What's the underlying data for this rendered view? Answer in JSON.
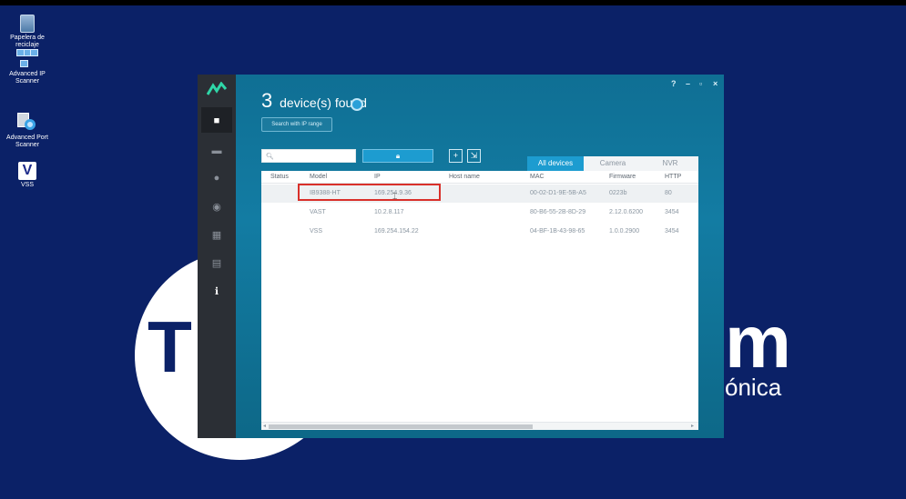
{
  "desktop": {
    "icons": [
      {
        "label": "Papelera de reciclaje",
        "icon": "recycle-bin-icon"
      },
      {
        "label": "Advanced IP Scanner",
        "icon": "network-scanner-icon"
      },
      {
        "label": "Advanced Port Scanner",
        "icon": "port-scanner-icon"
      },
      {
        "label": "VSS",
        "icon": "vss-app-icon"
      }
    ],
    "background_text": {
      "left": "T",
      "right_big": "m",
      "right_small": "ónica"
    },
    "colors": {
      "background": "#0b2167",
      "logo_circle": "#ffffff"
    }
  },
  "window": {
    "controls": {
      "help": "?",
      "minimize": "–",
      "maximize": "▫",
      "close": "×"
    },
    "title": {
      "count": "3",
      "text": "device(s) found"
    },
    "ip_range_button": "Search with IP range",
    "search_placeholder": "",
    "toolbar": {
      "lock_icon": "lock-icon",
      "add": "+",
      "import": "import-icon"
    },
    "tabs": [
      {
        "label": "All devices",
        "active": true
      },
      {
        "label": "Camera",
        "active": false
      },
      {
        "label": "NVR",
        "active": false
      }
    ],
    "sidebar_icons": [
      "home-icon",
      "monitor-icon",
      "location-icon",
      "playback-icon",
      "grid-icon",
      "report-icon",
      "info-icon"
    ],
    "columns": [
      "Status",
      "Model",
      "IP",
      "Host name",
      "MAC",
      "Firmware",
      "HTTP"
    ],
    "rows": [
      {
        "status": "",
        "model": "IB9388-HT",
        "ip": "169.254.9.36",
        "host": "",
        "mac": "00-02-D1-9E-5B-A5",
        "firmware": "0223b",
        "http": "80",
        "selected": true
      },
      {
        "status": "",
        "model": "VAST",
        "ip": "10.2.8.117",
        "host": "",
        "mac": "80-B6-55-2B-8D-29",
        "firmware": "2.12.0.6200",
        "http": "3454",
        "selected": false
      },
      {
        "status": "",
        "model": "VSS",
        "ip": "169.254.154.22",
        "host": "",
        "mac": "04-BF-1B-43-98-65",
        "firmware": "1.0.0.2900",
        "http": "3454",
        "selected": false
      }
    ],
    "colors": {
      "accent": "#1d9cd0",
      "sidebar": "#2b2f35",
      "highlight_box": "#d9302a"
    }
  }
}
